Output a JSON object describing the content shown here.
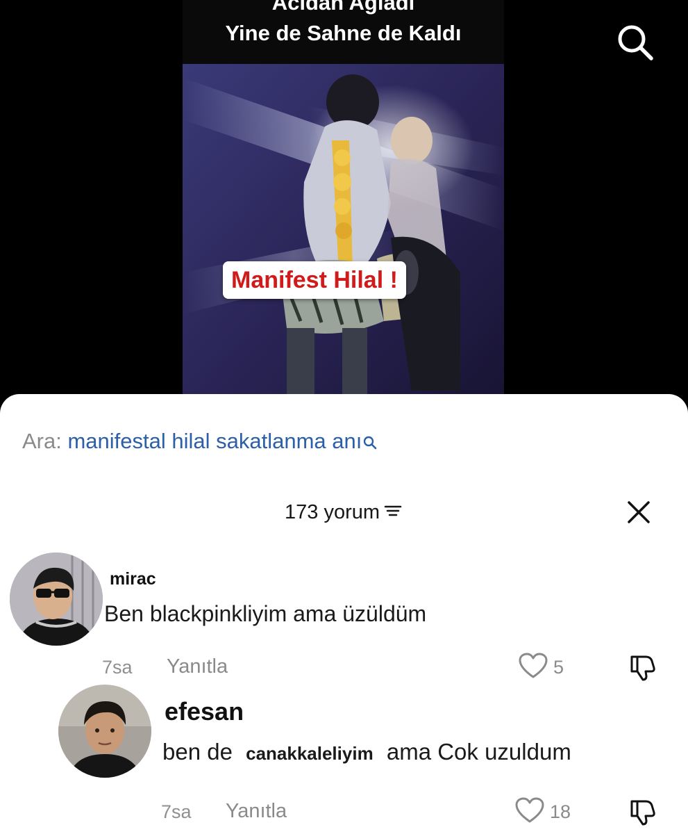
{
  "video": {
    "title_line1": "Acıdan Ağladı",
    "title_line2": "Yine de Sahne de Kaldı",
    "caption": "Manifest Hilal !"
  },
  "search": {
    "prefix": "Ara:",
    "query": "manifestal hilal sakatlanma anı"
  },
  "sheet": {
    "count_label": "173 yorum"
  },
  "comments": [
    {
      "username": "mirac",
      "text": "Ben blackpinkliyim ama üzüldüm",
      "time": "7sa",
      "reply_label": "Yanıtla",
      "likes": "5"
    },
    {
      "username": "efesan",
      "text_start": "ben de",
      "text_middle": "canakkaleliyim",
      "text_end": "ama Cok uzuldum",
      "time": "7sa",
      "reply_label": "Yanıtla",
      "likes": "18"
    }
  ],
  "icons": {
    "top_search": "search-icon",
    "suggest_search": "search-icon",
    "sort": "sort-icon",
    "close": "close-icon",
    "like": "heart-icon",
    "dislike": "thumbs-down-icon"
  },
  "colors": {
    "caption_red": "#d11a1a",
    "query_blue": "#2b5fa8",
    "muted_gray": "#8a8a8a"
  }
}
